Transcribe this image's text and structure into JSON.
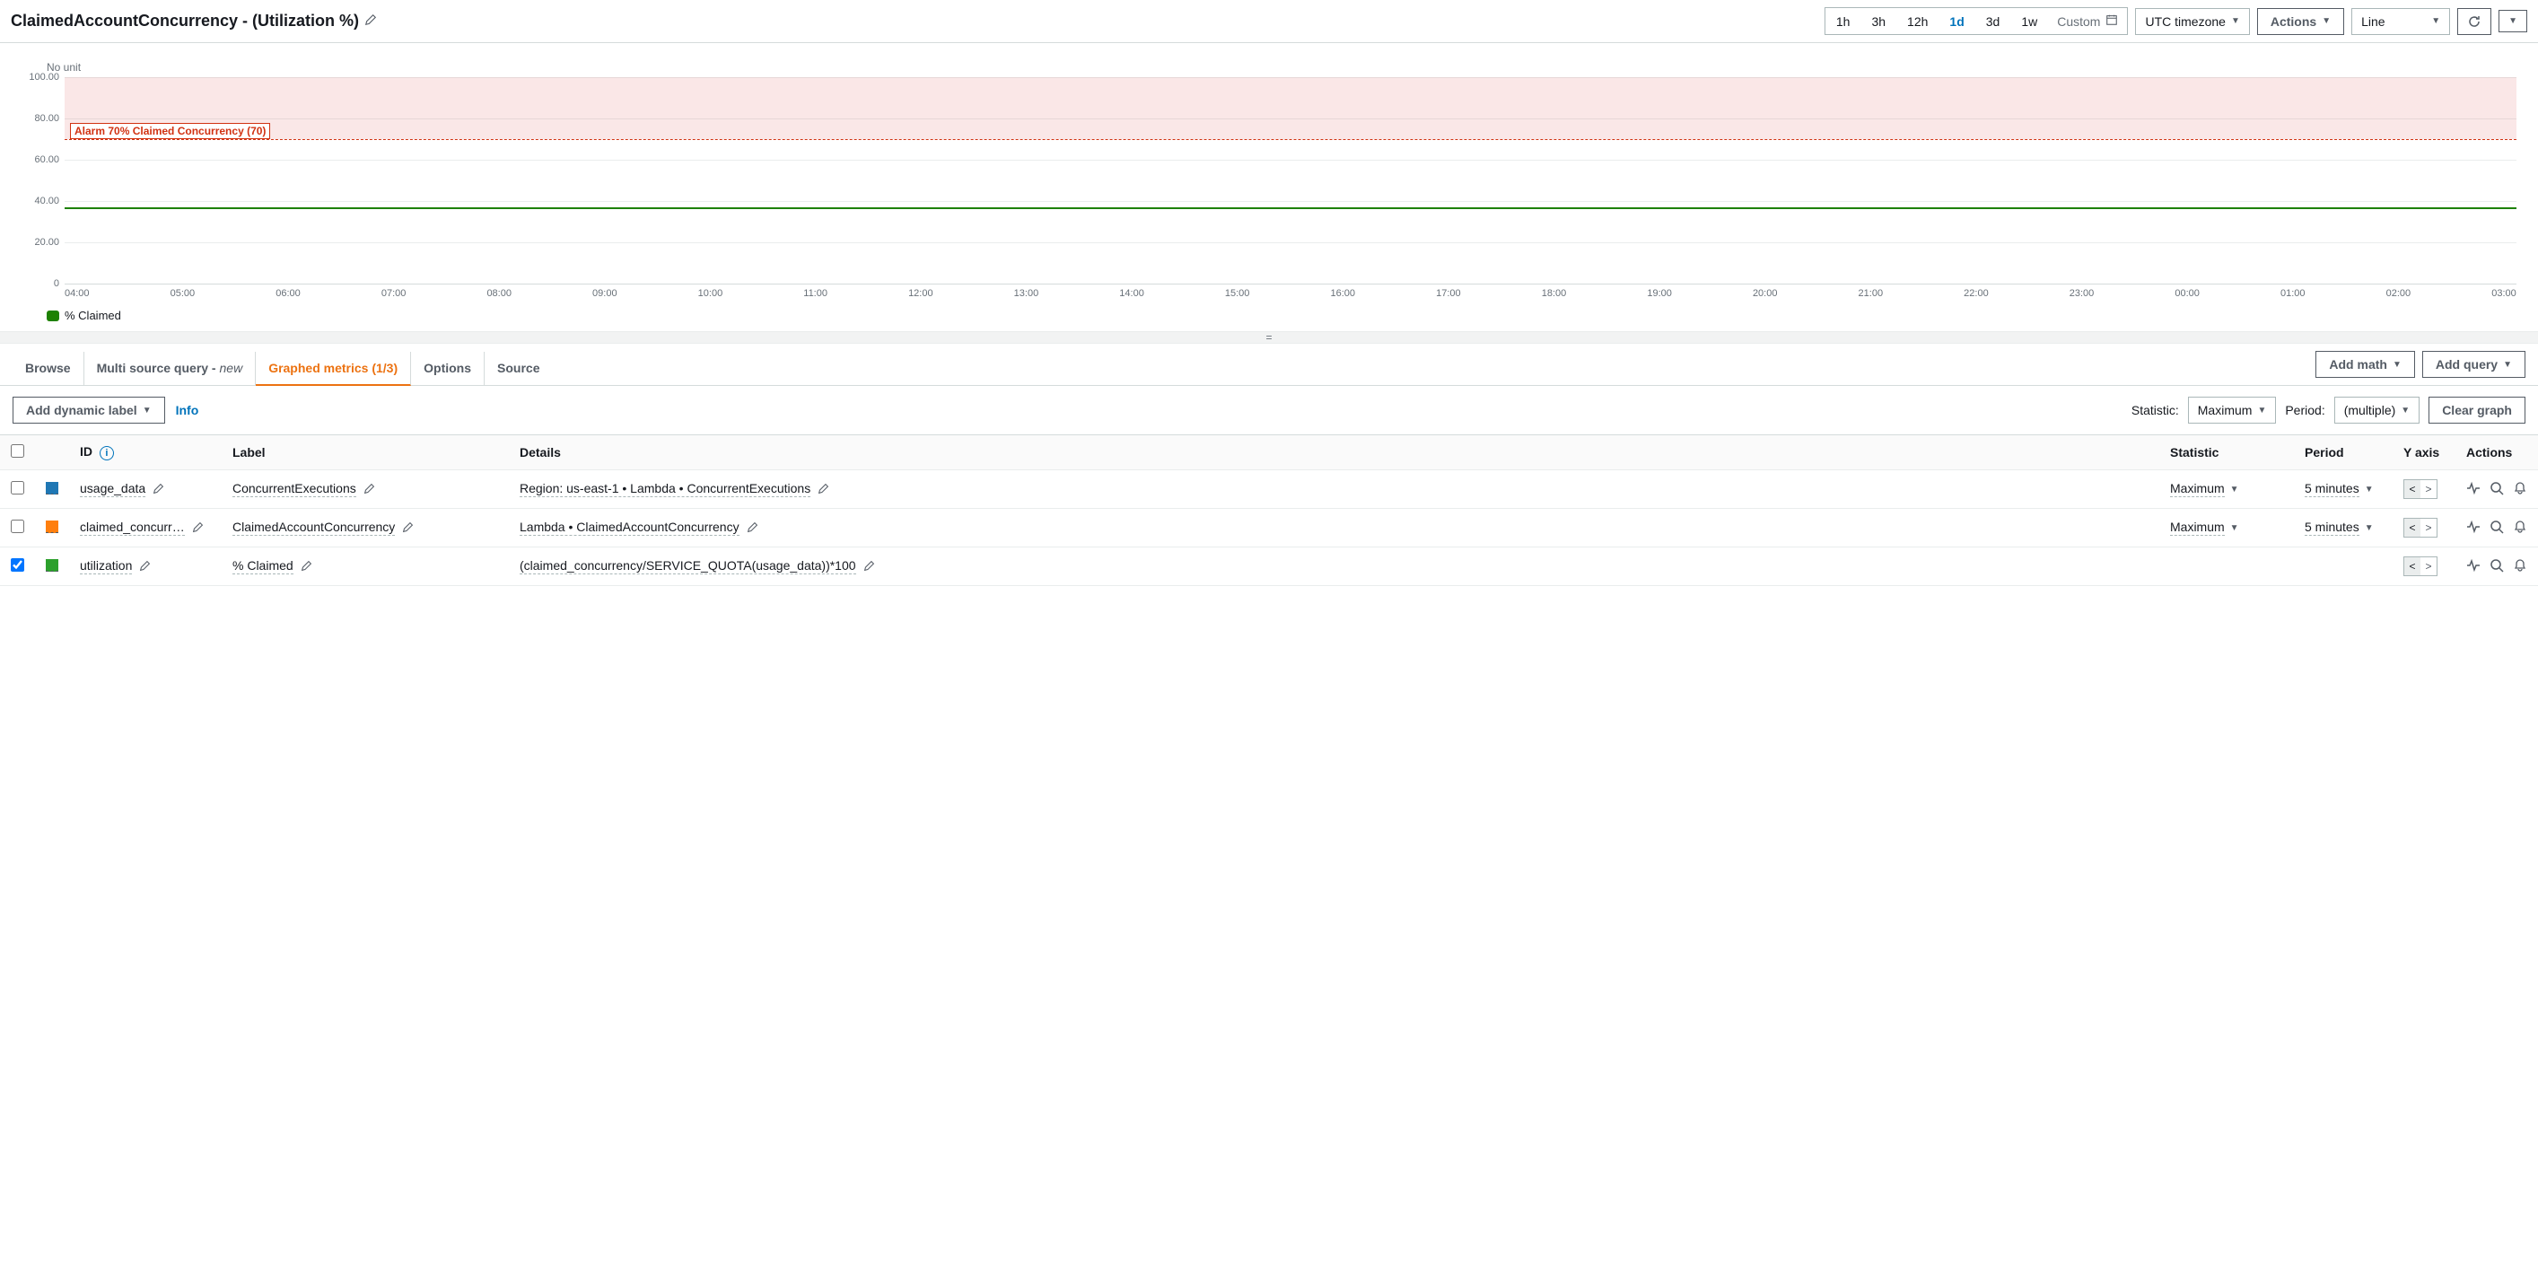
{
  "header": {
    "title": "ClaimedAccountConcurrency - (Utilization %)",
    "time_range": [
      "1h",
      "3h",
      "12h",
      "1d",
      "3d",
      "1w"
    ],
    "time_range_active": "1d",
    "custom_label": "Custom",
    "timezone": "UTC timezone",
    "actions_label": "Actions",
    "chart_type": "Line"
  },
  "chart_data": {
    "type": "line",
    "title": "",
    "ylabel": "No unit",
    "ylim": [
      0,
      100
    ],
    "y_ticks": [
      0,
      20.0,
      40.0,
      60.0,
      80.0,
      100.0
    ],
    "x_ticks": [
      "04:00",
      "05:00",
      "06:00",
      "07:00",
      "08:00",
      "09:00",
      "10:00",
      "11:00",
      "12:00",
      "13:00",
      "14:00",
      "15:00",
      "16:00",
      "17:00",
      "18:00",
      "19:00",
      "20:00",
      "21:00",
      "22:00",
      "23:00",
      "00:00",
      "01:00",
      "02:00",
      "03:00"
    ],
    "alarm": {
      "label": "Alarm 70% Claimed Concurrency (70)",
      "threshold": 70,
      "band_top": 100
    },
    "series": [
      {
        "name": "% Claimed",
        "color": "#1d8102",
        "approx_constant_value": 37
      }
    ],
    "legend": "% Claimed"
  },
  "tabs": {
    "items": [
      {
        "label": "Browse"
      },
      {
        "label_prefix": "Multi source query - ",
        "new_label": "new"
      },
      {
        "label": "Graphed metrics (1/3)",
        "active": true
      },
      {
        "label": "Options"
      },
      {
        "label": "Source"
      }
    ],
    "add_math": "Add math",
    "add_query": "Add query"
  },
  "sub_toolbar": {
    "add_dynamic_label": "Add dynamic label",
    "info": "Info",
    "statistic_label": "Statistic:",
    "statistic_value": "Maximum",
    "period_label": "Period:",
    "period_value": "(multiple)",
    "clear_graph": "Clear graph"
  },
  "table": {
    "columns": {
      "id": "ID",
      "label": "Label",
      "details": "Details",
      "statistic": "Statistic",
      "period": "Period",
      "yaxis": "Y axis",
      "actions": "Actions"
    },
    "rows": [
      {
        "checked": false,
        "color": "blue",
        "id": "usage_data",
        "label": "ConcurrentExecutions",
        "details": "Region: us-east-1 • Lambda • ConcurrentExecutions",
        "statistic": "Maximum",
        "period": "5 minutes",
        "yaxis_active": "left"
      },
      {
        "checked": false,
        "color": "orange",
        "id": "claimed_concurr…",
        "label": "ClaimedAccountConcurrency",
        "details": "Lambda • ClaimedAccountConcurrency",
        "statistic": "Maximum",
        "period": "5 minutes",
        "yaxis_active": "left"
      },
      {
        "checked": true,
        "color": "green",
        "id": "utilization",
        "label": "% Claimed",
        "details": "(claimed_concurrency/SERVICE_QUOTA(usage_data))*100",
        "statistic": "",
        "period": "",
        "yaxis_active": "left"
      }
    ]
  }
}
